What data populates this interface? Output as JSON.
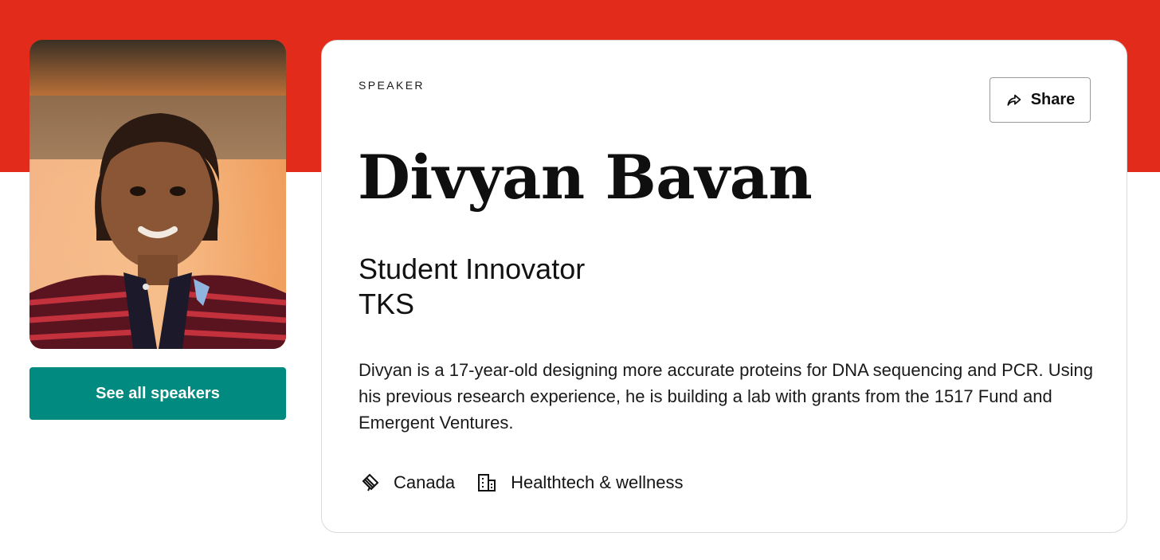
{
  "speaker": {
    "eyebrow": "SPEAKER",
    "name": "Divyan Bavan",
    "role": "Student Innovator",
    "organization": "TKS",
    "bio": "Divyan is a 17-year-old designing more accurate proteins for DNA sequencing and PCR. Using his previous research experience, he is building a lab with grants from the 1517 Fund and Emergent Ventures.",
    "location": "Canada",
    "industry": "Healthtech & wellness"
  },
  "actions": {
    "share_label": "Share",
    "see_all_label": "See all speakers"
  },
  "icons": {
    "share": "share-arrow-icon",
    "location": "flag-icon",
    "industry": "building-icon"
  },
  "colors": {
    "brand_red": "#e32b1c",
    "teal_button": "#008a80",
    "card_border": "#d9d9d9"
  }
}
